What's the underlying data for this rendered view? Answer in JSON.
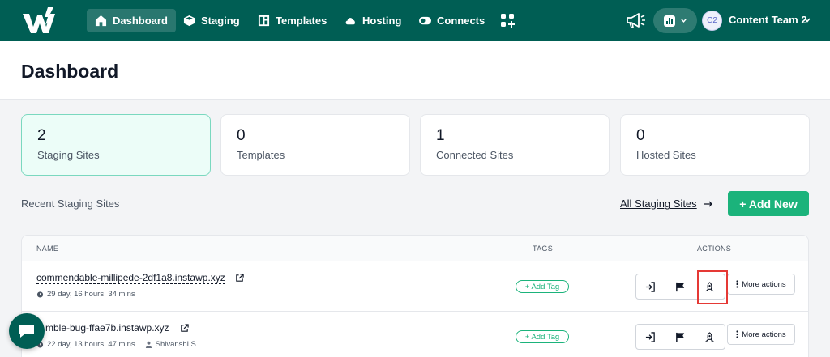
{
  "nav": {
    "items": [
      {
        "label": "Dashboard",
        "icon": "home-icon"
      },
      {
        "label": "Staging",
        "icon": "cube-icon"
      },
      {
        "label": "Templates",
        "icon": "template-icon"
      },
      {
        "label": "Hosting",
        "icon": "cloud-icon"
      },
      {
        "label": "Connects",
        "icon": "toggle-icon"
      }
    ],
    "team": {
      "initials": "C2",
      "name": "Content Team 2"
    }
  },
  "page": {
    "title": "Dashboard"
  },
  "stats": [
    {
      "value": "2",
      "label": "Staging Sites"
    },
    {
      "value": "0",
      "label": "Templates"
    },
    {
      "value": "1",
      "label": "Connected Sites"
    },
    {
      "value": "0",
      "label": "Hosted Sites"
    }
  ],
  "recent": {
    "label": "Recent Staging Sites",
    "all_link": "All Staging Sites",
    "add_new": "+ Add New"
  },
  "table": {
    "headers": {
      "name": "NAME",
      "tags": "TAGS",
      "actions": "ACTIONS"
    },
    "rows": [
      {
        "name": "commendable-millipede-2df1a8.instawp.xyz",
        "time": "29 day, 16 hours, 34 mins",
        "owner": "",
        "tag": "+ Add Tag",
        "more": "More actions"
      },
      {
        "name": "mble-bug-ffae7b.instawp.xyz",
        "time": "22 day, 13 hours, 47 mins",
        "owner": "Shivanshi S",
        "tag": "+ Add Tag",
        "more": "More actions"
      }
    ]
  },
  "colors": {
    "brand": "#005e54",
    "accent": "#1bb37b",
    "highlight": "#e53935"
  }
}
